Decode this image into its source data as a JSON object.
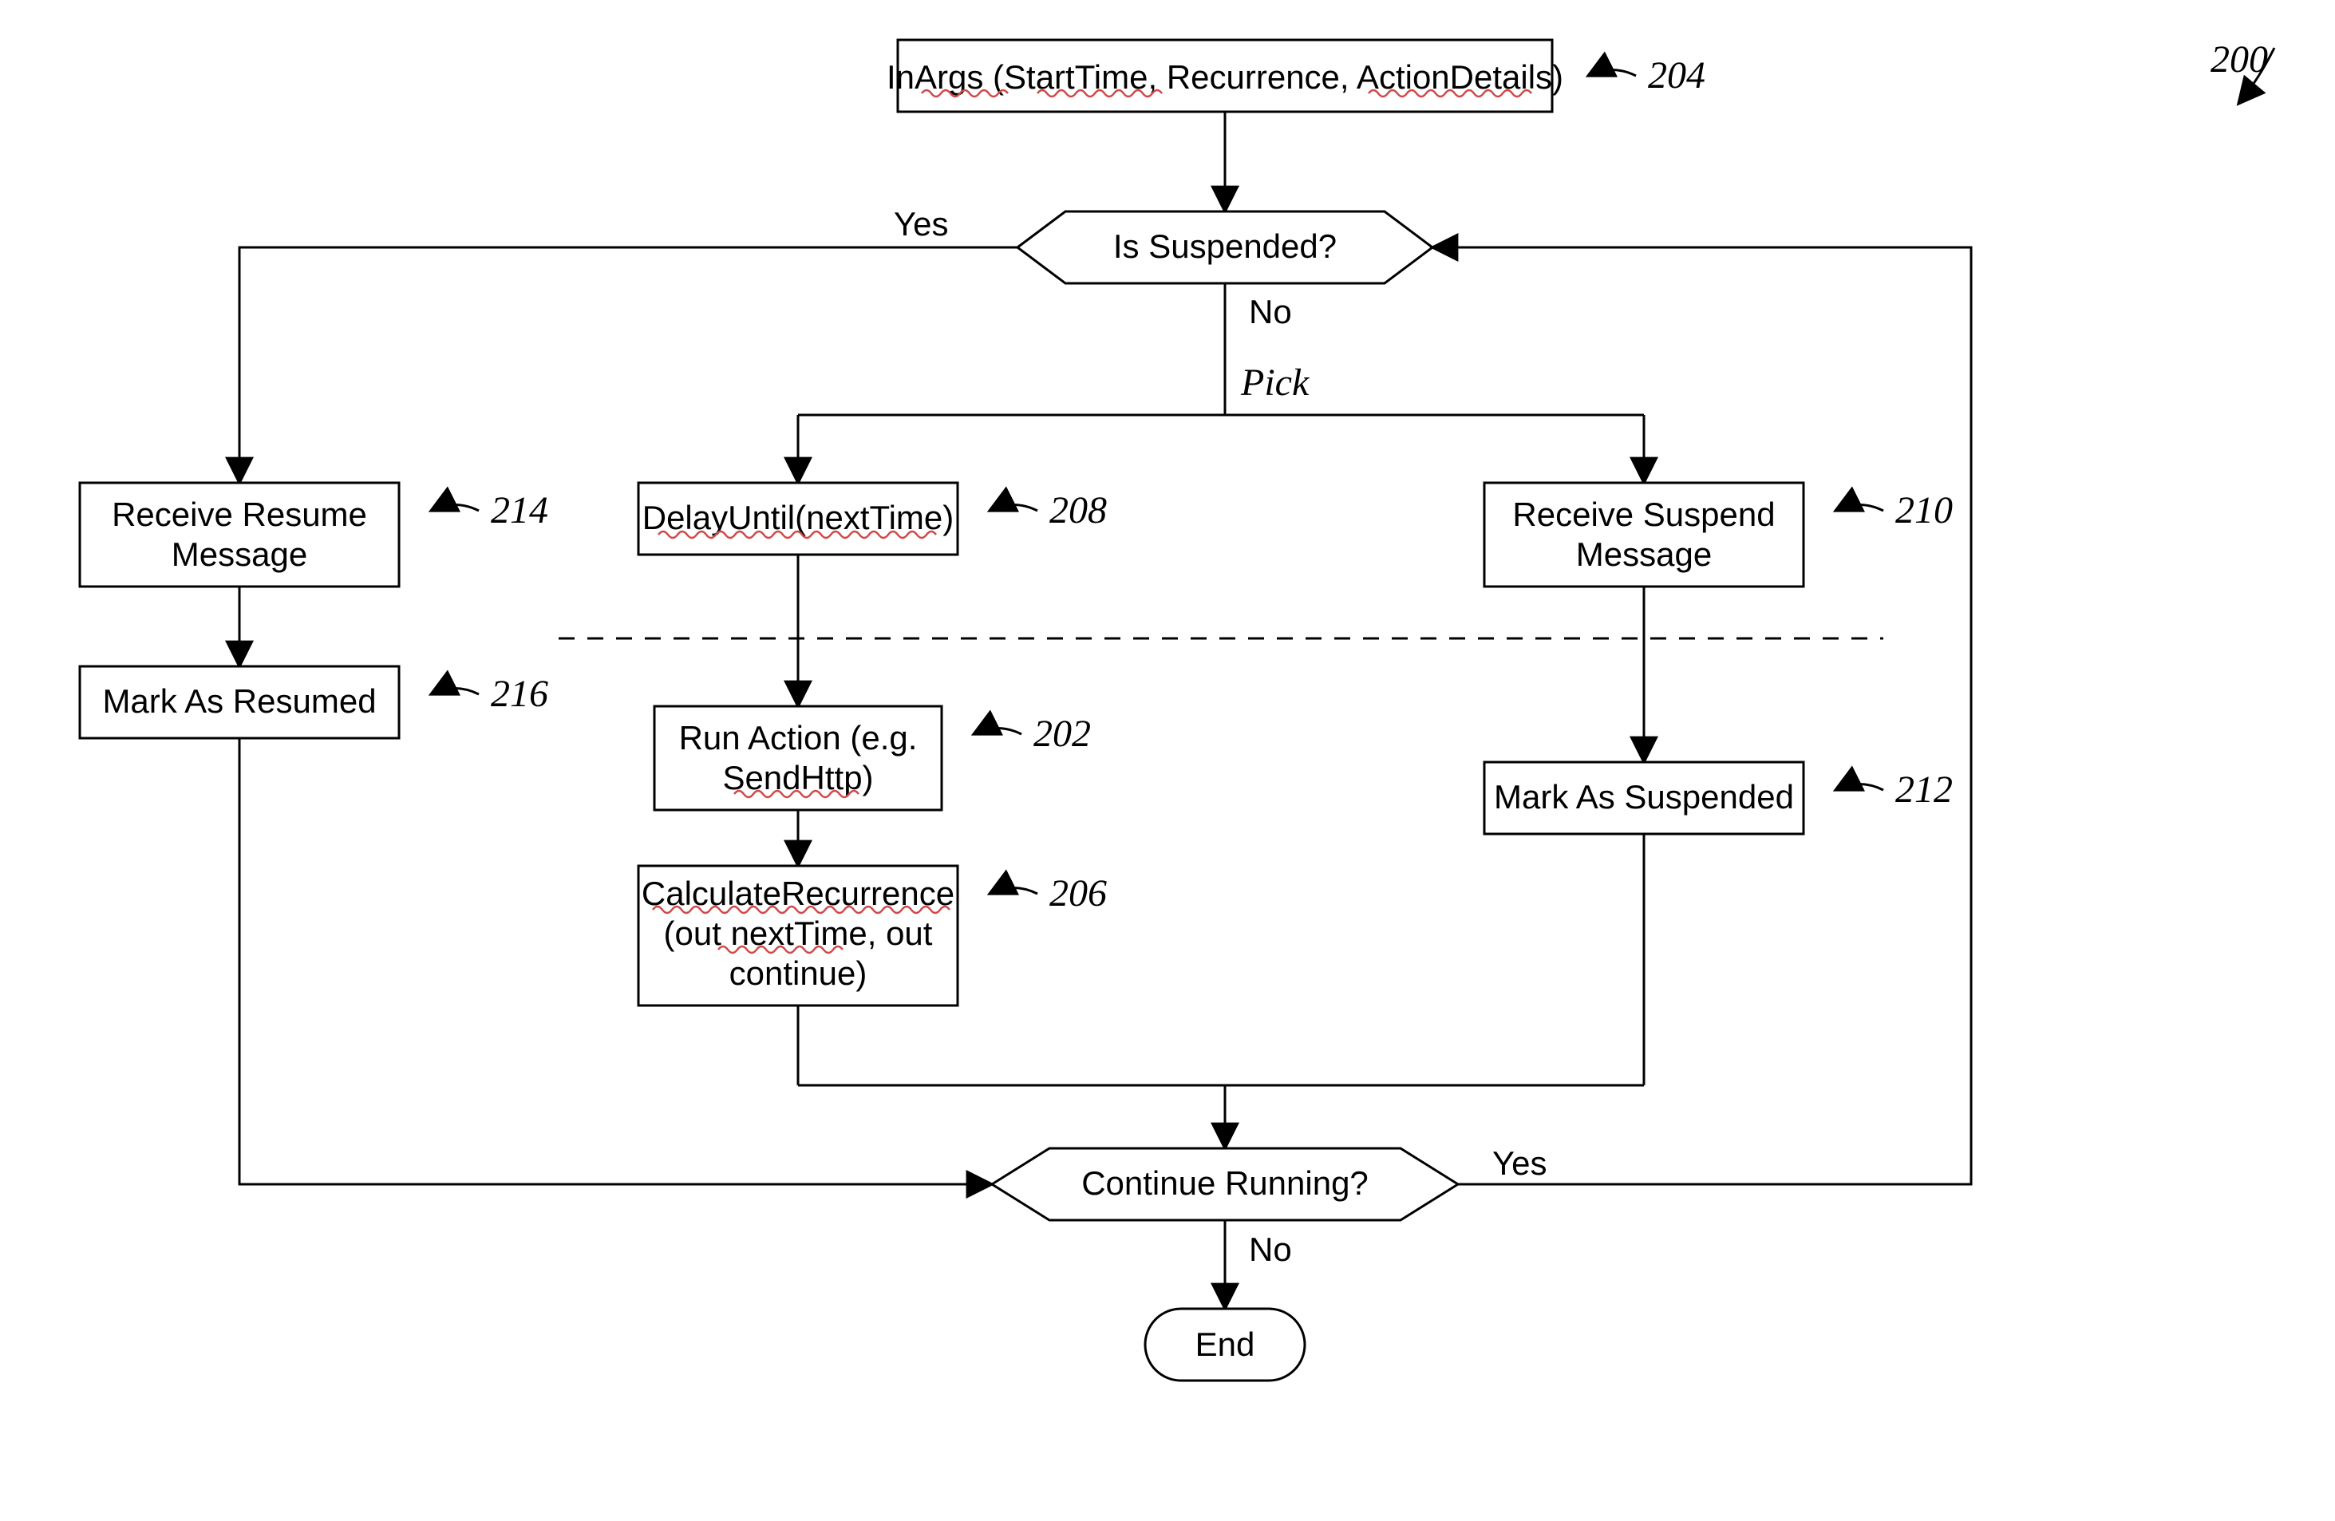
{
  "figure_ref": "200",
  "nodes": {
    "inargs": {
      "text": "InArgs (StartTime, Recurrence, ActionDetails)",
      "ref": "204"
    },
    "suspended": {
      "text": "Is Suspended?"
    },
    "pick_label": "Pick",
    "delay": {
      "text": "DelayUntil(nextTime)",
      "ref": "208"
    },
    "runaction": {
      "line1": "Run Action (e.g.",
      "line2": "SendHttp)",
      "ref": "202"
    },
    "calc": {
      "line1": "CalculateRecurrence",
      "line2": "(out nextTime, out",
      "line3": "continue)",
      "ref": "206"
    },
    "recvsuspend": {
      "line1": "Receive Suspend",
      "line2": "Message",
      "ref": "210"
    },
    "marksuspended": {
      "text": "Mark As Suspended",
      "ref": "212"
    },
    "recvresume": {
      "line1": "Receive Resume",
      "line2": "Message",
      "ref": "214"
    },
    "markresumed": {
      "text": "Mark As Resumed",
      "ref": "216"
    },
    "continue": {
      "text": "Continue Running?"
    },
    "end": {
      "text": "End"
    }
  },
  "edge_labels": {
    "yes1": "Yes",
    "no1": "No",
    "yes2": "Yes",
    "no2": "No"
  }
}
